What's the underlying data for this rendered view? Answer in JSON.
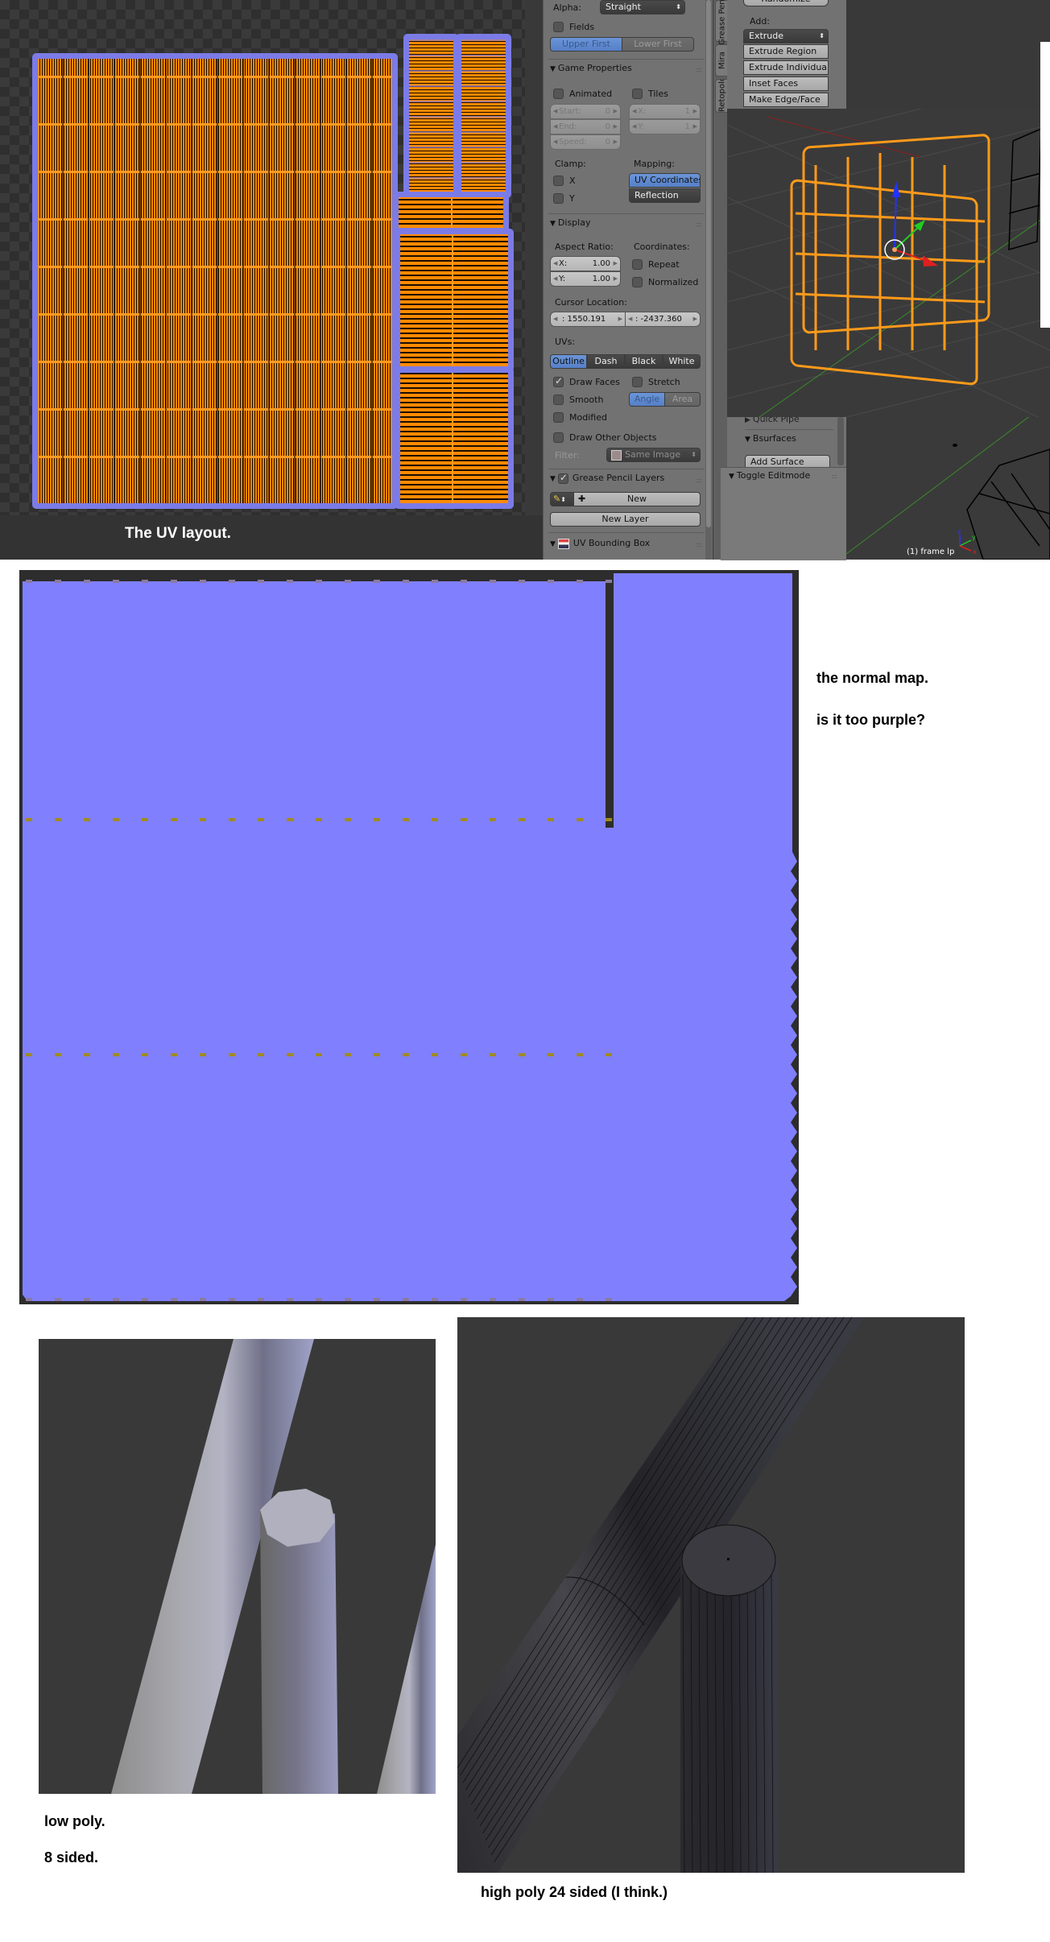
{
  "uv_editor": {
    "caption": "The UV layout.",
    "colors": {
      "island_outline": "#7b7be8",
      "face_fill": "#ff8a00",
      "edge": "#1a0d00"
    }
  },
  "properties_panel": {
    "alpha_label": "Alpha:",
    "alpha_value": "Straight",
    "fields_label": "Fields",
    "field_order": [
      "Upper First",
      "Lower First"
    ],
    "game_properties": {
      "title": "Game Properties",
      "animated_label": "Animated",
      "tiles_label": "Tiles",
      "start": {
        "label": "Start:",
        "value": "0"
      },
      "end": {
        "label": "End:",
        "value": "0"
      },
      "speed": {
        "label": "Speed:",
        "value": "0"
      },
      "tiles_x": {
        "label": "X:",
        "value": "1"
      },
      "tiles_y": {
        "label": "Y:",
        "value": "1"
      },
      "clamp_label": "Clamp:",
      "clamp_x": "X",
      "clamp_y": "Y",
      "mapping_label": "Mapping:",
      "mapping_options": [
        "UV Coordinates",
        "Reflection"
      ]
    },
    "display": {
      "title": "Display",
      "aspect_label": "Aspect Ratio:",
      "aspect_x": {
        "label": "X:",
        "value": "1.00"
      },
      "aspect_y": {
        "label": "Y:",
        "value": "1.00"
      },
      "coordinates_label": "Coordinates:",
      "repeat_label": "Repeat",
      "normalized_label": "Normalized",
      "cursor_label": "Cursor Location:",
      "cursor_x": ": 1550.191",
      "cursor_y": ": -2437.360",
      "uvs_label": "UVs:",
      "uv_modes": [
        "Outline",
        "Dash",
        "Black",
        "White"
      ],
      "draw_faces_label": "Draw Faces",
      "stretch_label": "Stretch",
      "smooth_label": "Smooth",
      "stretch_modes": [
        "Angle",
        "Area"
      ],
      "modified_label": "Modified",
      "draw_other_label": "Draw Other Objects",
      "filter_label": "Filter:",
      "filter_value": "Same Image"
    },
    "grease_pencil": {
      "title": "Grease Pencil Layers",
      "new_label": "New",
      "new_layer_label": "New Layer"
    },
    "uv_bounding_box": {
      "title": "UV Bounding Box"
    }
  },
  "tool_shelf": {
    "tabs": [
      "Grease Pencil",
      "Mira",
      "Retopology"
    ],
    "randomize_label": "Randomize",
    "add_label": "Add:",
    "add_value": "Extrude",
    "add_items": [
      "Extrude Region",
      "Extrude Individual",
      "Inset Faces",
      "Make Edge/Face"
    ],
    "quick_pipe_label": "Quick Pipe",
    "bsurfaces_label": "Bsurfaces",
    "add_surface_label": "Add Surface",
    "toggle_editmode_label": "Toggle Editmode"
  },
  "viewport": {
    "object_label": "(1) frame lp",
    "axis": {
      "x": "x",
      "y": "y",
      "z": "z"
    }
  },
  "normal_map": {
    "caption_1": "the normal map.",
    "caption_2": "is it too purple?",
    "base_color": "#8080ff"
  },
  "low_poly": {
    "caption_1": "low poly.",
    "caption_2": "8 sided."
  },
  "high_poly": {
    "caption": "high poly 24 sided (I think.)"
  }
}
